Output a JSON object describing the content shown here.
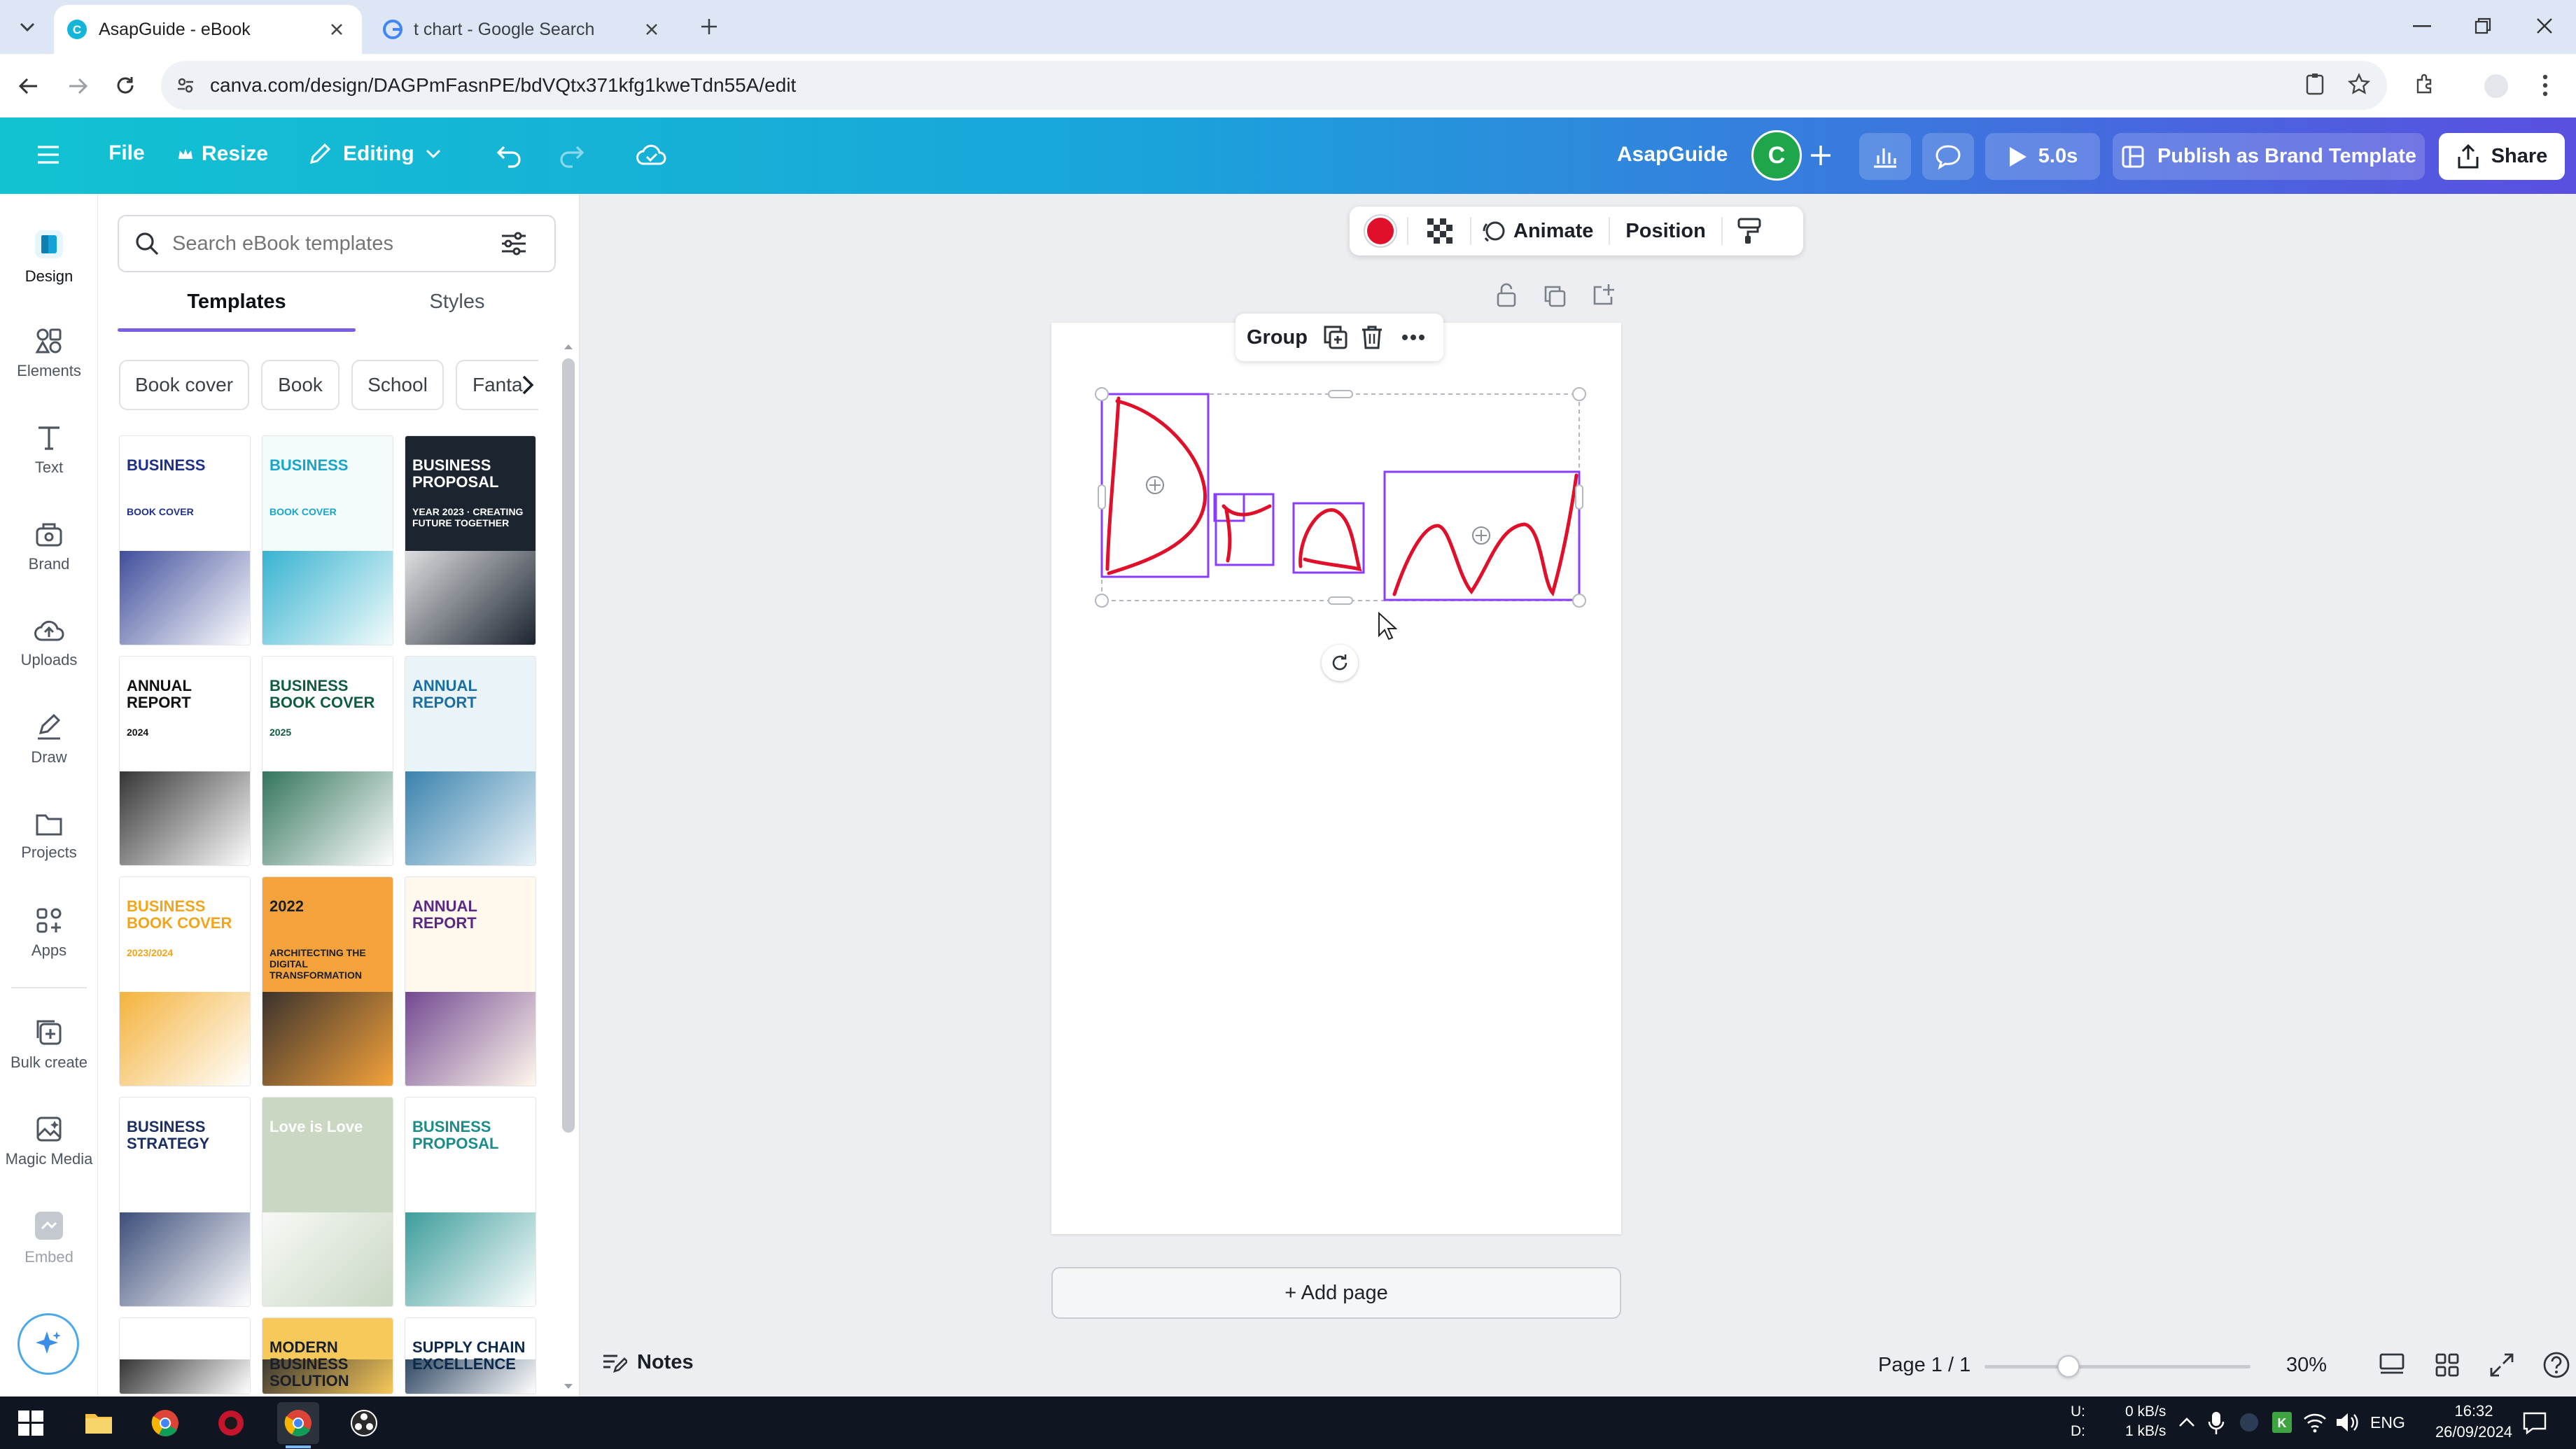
{
  "browser": {
    "tabs": [
      {
        "title": "AsapGuide - eBook",
        "active": true
      },
      {
        "title": "t chart - Google Search",
        "active": false
      }
    ],
    "url": "canva.com/design/DAGPmFasnPE/bdVQtx371kfg1kweTdn55A/edit"
  },
  "header": {
    "file_label": "File",
    "resize_label": "Resize",
    "editing_label": "Editing",
    "doc_name": "AsapGuide",
    "avatar_letter": "C",
    "play_label": "5.0s",
    "publish_label": "Publish as Brand Template",
    "share_label": "Share"
  },
  "rail": {
    "items": [
      {
        "label": "Design",
        "icon": "design-icon"
      },
      {
        "label": "Elements",
        "icon": "elements-icon"
      },
      {
        "label": "Text",
        "icon": "text-icon"
      },
      {
        "label": "Brand",
        "icon": "brand-icon"
      },
      {
        "label": "Uploads",
        "icon": "uploads-icon"
      },
      {
        "label": "Draw",
        "icon": "draw-icon"
      },
      {
        "label": "Projects",
        "icon": "projects-icon"
      },
      {
        "label": "Apps",
        "icon": "apps-icon"
      },
      {
        "label": "Bulk create",
        "icon": "bulk-create-icon"
      },
      {
        "label": "Magic Media",
        "icon": "magic-media-icon"
      },
      {
        "label": "Embed",
        "icon": "embed-icon"
      }
    ]
  },
  "panel": {
    "search_placeholder": "Search eBook templates",
    "tab_templates": "Templates",
    "tab_styles": "Styles",
    "chips": [
      "Book cover",
      "Book",
      "School",
      "Fanta"
    ],
    "thumbs": [
      {
        "title": "BUSINESS",
        "sub": "BOOK COVER",
        "bg": "#ffffff",
        "fg": "#1e2f8a"
      },
      {
        "title": "BUSINESS",
        "sub": "BOOK COVER",
        "bg": "#f3fbfb",
        "fg": "#16a6c9"
      },
      {
        "title": "BUSINESS PROPOSAL",
        "sub": "YEAR 2023 · CREATING FUTURE TOGETHER",
        "bg": "#1c2430",
        "fg": "#ffffff"
      },
      {
        "title": "ANNUAL REPORT",
        "sub": "2024",
        "bg": "#ffffff",
        "fg": "#111111"
      },
      {
        "title": "BUSINESS BOOK COVER",
        "sub": "2025",
        "bg": "#ffffff",
        "fg": "#0f5d40"
      },
      {
        "title": "ANNUAL REPORT",
        "sub": "",
        "bg": "#eaf3f8",
        "fg": "#1a6fa0"
      },
      {
        "title": "BUSINESS BOOK COVER",
        "sub": "2023/2024",
        "bg": "#ffffff",
        "fg": "#f2a51a"
      },
      {
        "title": "2022",
        "sub": "ARCHITECTING THE DIGITAL TRANSFORMATION",
        "bg": "#f4a23b",
        "fg": "#1b1f2a"
      },
      {
        "title": "ANNUAL REPORT",
        "sub": "",
        "bg": "#fff8ec",
        "fg": "#5a2a82"
      },
      {
        "title": "BUSINESS STRATEGY",
        "sub": "",
        "bg": "#ffffff",
        "fg": "#1b2f63"
      },
      {
        "title": "Love is Love",
        "sub": "",
        "bg": "#c9d7c3",
        "fg": "#ffffff"
      },
      {
        "title": "BUSINESS PROPOSAL",
        "sub": "",
        "bg": "#ffffff",
        "fg": "#1a8c8a"
      },
      {
        "title": "",
        "sub": "",
        "bg": "#ffffff",
        "fg": "#111111"
      },
      {
        "title": "MODERN BUSINESS SOLUTION",
        "sub": "",
        "bg": "#f7c85a",
        "fg": "#1b1f2a"
      },
      {
        "title": "SUPPLY CHAIN EXCELLENCE",
        "sub": "",
        "bg": "#ffffff",
        "fg": "#0e2a4a"
      }
    ]
  },
  "toolbar": {
    "color": "#e0102a",
    "animate_label": "Animate",
    "position_label": "Position"
  },
  "group_bar": {
    "group_label": "Group"
  },
  "canvas": {
    "add_page_label": "+ Add page"
  },
  "footer": {
    "notes_label": "Notes",
    "page_label": "Page 1 / 1",
    "zoom_label": "30%",
    "zoom_level": 0.3
  },
  "taskbar": {
    "net_up_label": "U:",
    "net_down_label": "D:",
    "net_up": "0 kB/s",
    "net_down": "1 kB/s",
    "lang": "ENG",
    "time": "16:32",
    "date": "26/09/2024"
  }
}
